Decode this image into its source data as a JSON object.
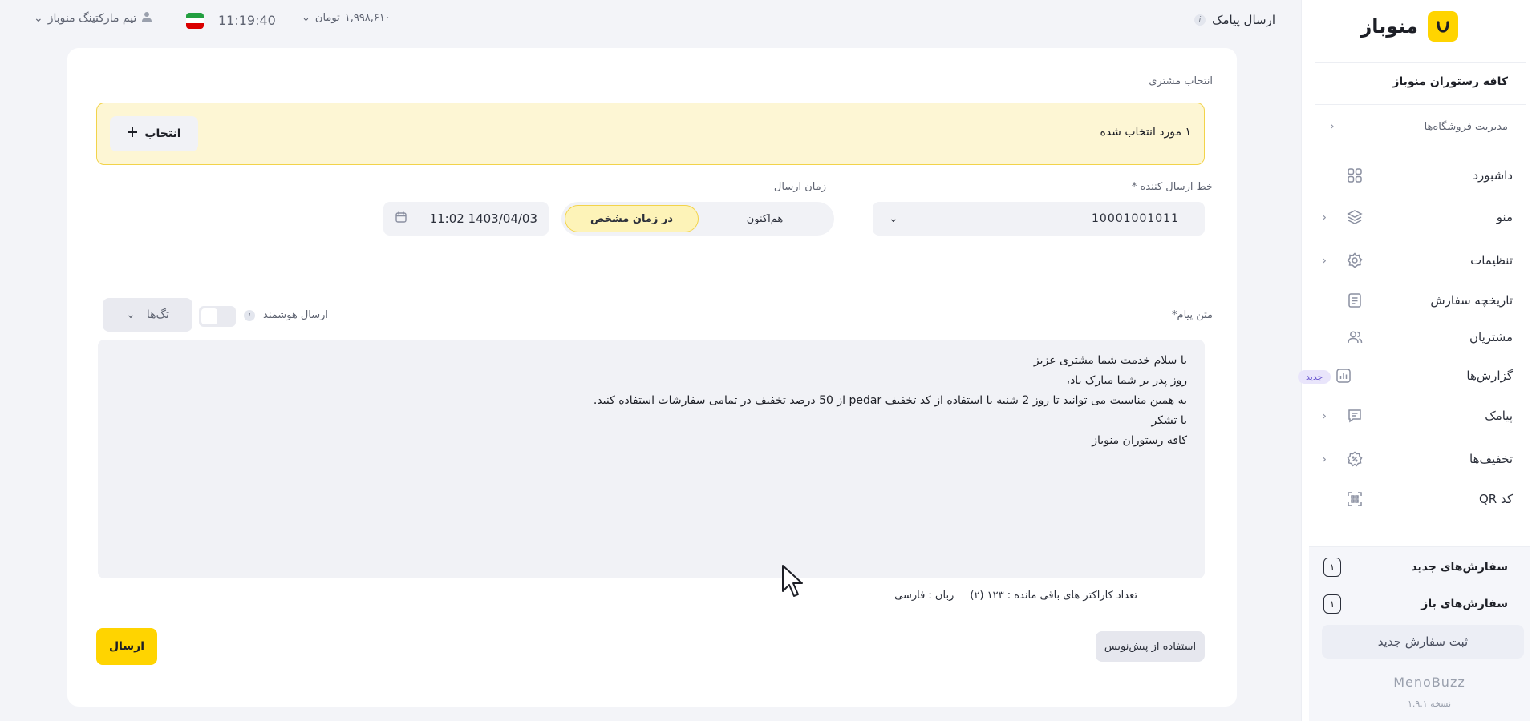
{
  "sidebar": {
    "brand": "منوباز",
    "cafe_name": "کافه رستوران منوباز",
    "store_management": "مدیریت فروشگاه‌ها",
    "items": [
      {
        "label": "داشبورد",
        "icon": "dashboard-icon"
      },
      {
        "label": "منو",
        "icon": "layers-icon"
      },
      {
        "label": "تنظیمات",
        "icon": "gear-icon"
      },
      {
        "label": "تاریخچه سفارش",
        "icon": "history-icon"
      },
      {
        "label": "مشتریان",
        "icon": "users-icon"
      },
      {
        "label": "گزارش‌ها",
        "icon": "chart-icon",
        "badge": "جدید"
      },
      {
        "label": "پیامک",
        "icon": "message-icon"
      },
      {
        "label": "تخفیف‌ها",
        "icon": "discount-icon"
      },
      {
        "label": "کد QR",
        "icon": "qr-icon"
      }
    ],
    "new_orders_label": "سفارش‌های جدید",
    "new_orders_count": "۱",
    "open_orders_label": "سفارش‌های باز",
    "open_orders_count": "۱",
    "new_order_button": "ثبت سفارش جدید",
    "footer_logo": "MenoBuzz",
    "version": "نسخه ۱.۹.۱"
  },
  "header": {
    "title": "ارسال پیامک",
    "user": "تیم مارکتینگ منوباز",
    "time": "11:19:40",
    "balance": "۱,۹۹۸,۶۱۰",
    "balance_unit": "تومان"
  },
  "form": {
    "customer_select_label": "انتخاب مشتری",
    "selected_text": "۱ مورد انتخاب شده",
    "select_button": "انتخاب",
    "sender_line_label": "خط ارسال کننده *",
    "sender_line_value": "10001001011",
    "send_time_label": "زمان ارسال",
    "time_option_now": "هم‌اکنون",
    "time_option_scheduled": "در زمان مشخص",
    "date_value": "11:02 1403/04/03",
    "message_label": "متن پیام*",
    "smart_send_label": "ارسال هوشمند",
    "tags_button": "تگ‌ها",
    "message_lines": [
      "با سلام خدمت شما مشتری عزیز",
      "روز پدر بر شما مبارک باد،",
      "به همین مناسبت می توانید تا روز 2 شنبه با استفاده از کد تخفیف pedar از 50 درصد تخفیف در تمامی سفارشات استفاده کنید.",
      "با تشکر",
      "کافه رستوران منوباز"
    ],
    "remaining_chars": "تعداد کاراکتر های باقی مانده : ۱۲۳ (۲)",
    "language": "زبان : فارسی",
    "draft_button": "استفاده از پیش‌نویس",
    "send_button": "ارسال"
  },
  "colors": {
    "accent": "#ffd400",
    "selected_bg": "#fdf6d4",
    "selected_border": "#f2d34a",
    "badge": "#6d5bd0"
  }
}
